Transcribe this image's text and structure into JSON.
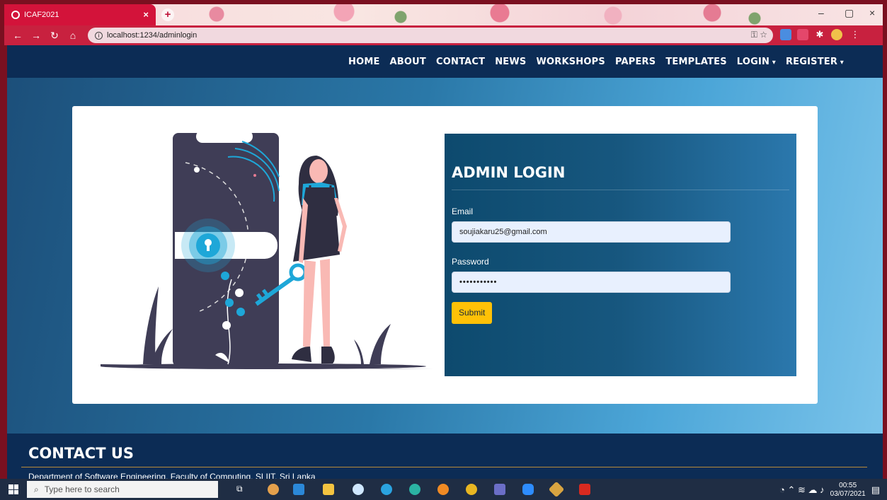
{
  "browser": {
    "tab_title": "ICAF2021",
    "new_tab": "+",
    "url": "localhost:1234/adminlogin"
  },
  "nav": {
    "items": [
      "HOME",
      "ABOUT",
      "CONTACT",
      "NEWS",
      "WORKSHOPS",
      "PAPERS",
      "TEMPLATES",
      "LOGIN",
      "REGISTER"
    ]
  },
  "login": {
    "title": "ADMIN LOGIN",
    "email_label": "Email",
    "email_value": "soujiakaru25@gmail.com",
    "password_label": "Password",
    "password_value": "•••••••••••",
    "submit_label": "Submit"
  },
  "footer": {
    "title": "CONTACT US",
    "subtitle": "Department of Software Engineering, Faculty of Computing, SLIIT, Sri Lanka"
  },
  "taskbar": {
    "search_placeholder": "Type here to search",
    "time": "00:55",
    "date": "03/07/2021"
  },
  "colors": {
    "nav_bg": "#0c2c55",
    "login_panel": "#17577f",
    "submit": "#ffc107",
    "tab": "#d3133a",
    "accent_blue": "#1ea7d8"
  }
}
